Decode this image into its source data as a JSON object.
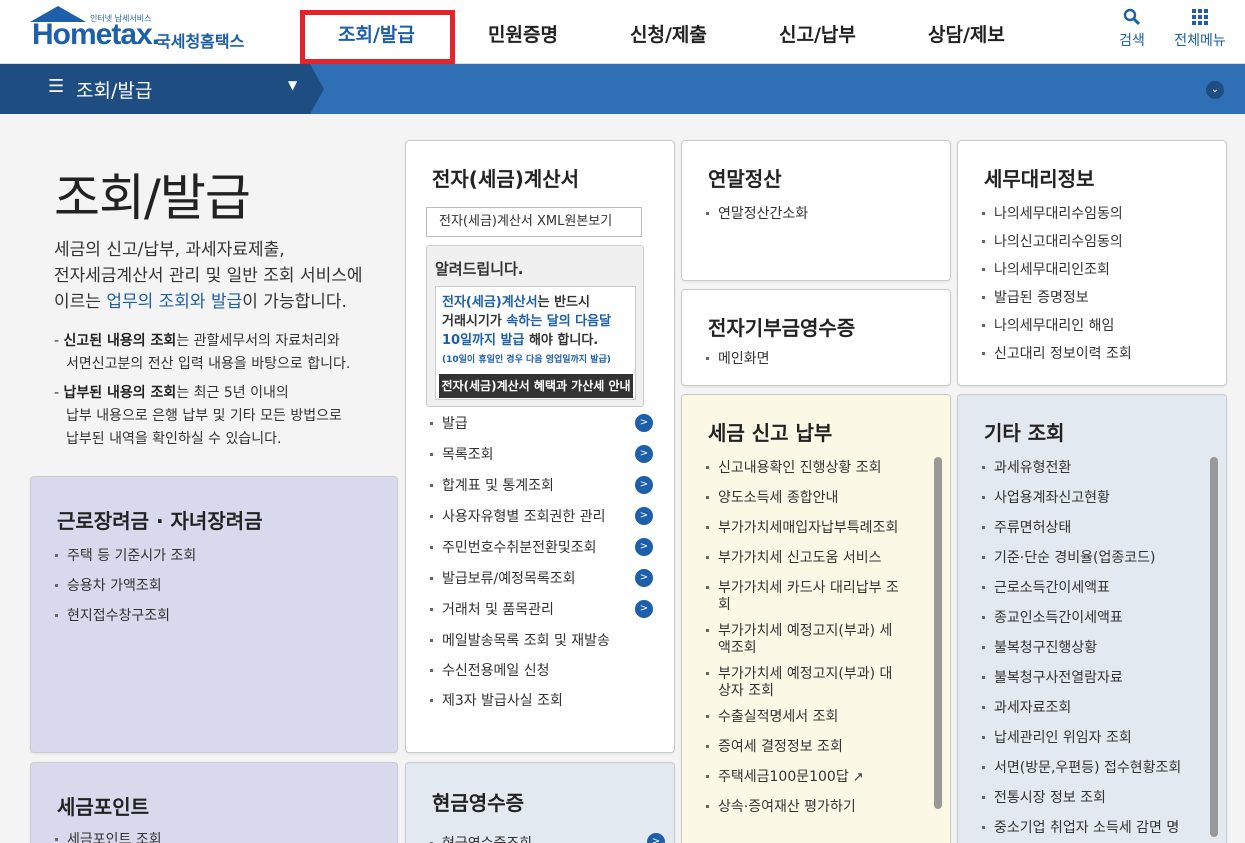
{
  "header": {
    "logo_small": "인터넷 납세서비스",
    "logo_word": "Hometax.",
    "logo_kor": "국세청홈택스",
    "nav": [
      "조회/발급",
      "민원증명",
      "신청/제출",
      "신고/납부",
      "상담/제보"
    ],
    "search_label": "검색",
    "all_menu_label": "전체메뉴"
  },
  "breadcrumb": {
    "label": "조회/발급"
  },
  "intro": {
    "title": "조회/발급",
    "desc_1": "세금의 신고/납부, 과세자료제출,",
    "desc_2": "전자세금계산서 관리 및 일반 조회 서비스에",
    "desc_3a": "이르는 ",
    "desc_3b": "업무의 조회와 발급",
    "desc_3c": "이 가능합니다.",
    "note1_bold": "신고된 내용의 조회",
    "note1_rest": "는 관할세무서의 자료처리와",
    "note1_line2": "서면신고분의 전산 입력 내용을 바탕으로 합니다.",
    "note2_bold": "납부된 내용의 조회",
    "note2_rest": "는 최근 5년 이내의",
    "note2_line2": "납부 내용으로 은행 납부 및 기타 모든 방법으로",
    "note2_line3": "납부된 내역을 확인하실 수 있습니다."
  },
  "cards": {
    "einvoice": {
      "title": "전자(세금)계산서",
      "xml_button": "전자(세금)계산서 XML원본보기",
      "notice_title": "알려드립니다.",
      "notice_line1a": "전자(세금)계산서",
      "notice_line1b": "는 반드시",
      "notice_line2a": "거래시기가 ",
      "notice_line2b": "속하는 달의 다음달",
      "notice_line3a": "10일까지 발급",
      "notice_line3b": " 해야 합니다.",
      "notice_small": "(10일이 휴일인 경우 다음 영업일까지 발급)",
      "notice_button": "전자(세금)계산서 혜택과 가산세 안내",
      "items": [
        "발급",
        "목록조회",
        "합계표 및 통계조회",
        "사용자유형별 조회권한 관리",
        "주민번호수취분전환및조회",
        "발급보류/예정목록조회",
        "거래처 및 품목관리",
        "메일발송목록 조회 및 재발송",
        "수신전용메일 신청",
        "제3자 발급사실 조회"
      ]
    },
    "yearend": {
      "title": "연말정산",
      "items": [
        "연말정산간소화"
      ]
    },
    "donation": {
      "title": "전자기부금영수증",
      "items": [
        "메인화면"
      ]
    },
    "agent": {
      "title": "세무대리정보",
      "items": [
        "나의세무대리수임동의",
        "나의신고대리수임동의",
        "나의세무대리인조회",
        "발급된 증명정보",
        "나의세무대리인 해임",
        "신고대리 정보이력 조회"
      ]
    },
    "tax": {
      "title": "세금 신고 납부",
      "items": [
        "신고내용확인 진행상황 조회",
        "양도소득세 종합안내",
        "부가가치세매입자납부특례조회",
        "부가가치세 신고도움 서비스",
        "부가가치세 카드사 대리납부 조",
        "회",
        "부가가치세 예정고지(부과) 세",
        "액조회",
        "부가가치세 예정고지(부과) 대",
        "상자 조회",
        "수출실적명세서 조회",
        "증여세 결정정보 조회",
        "주택세금100문100답",
        "상속·증여재산 평가하기"
      ]
    },
    "etc": {
      "title": "기타 조회",
      "items": [
        "과세유형전환",
        "사업용계좌신고현황",
        "주류면허상태",
        "기준·단순 경비율(업종코드)",
        "근로소득간이세액표",
        "종교인소득간이세액표",
        "불복청구진행상황",
        "불복청구사전열람자료",
        "과세자료조회",
        "납세관리인 위임자 조회",
        "서면(방문,우편등) 접수현황조회",
        "전통시장 정보 조회",
        "중소기업 취업자 소득세 감면 명"
      ]
    },
    "labor": {
      "title": "근로장려금 · 자녀장려금",
      "items": [
        "주택 등 기준시가 조회",
        "승용차 가액조회",
        "현지접수창구조회"
      ]
    },
    "point": {
      "title": "세금포인트",
      "items": [
        "세금포인트 조회"
      ]
    },
    "cash": {
      "title": "현금영수증",
      "items": [
        "현금영수증조회"
      ]
    }
  }
}
